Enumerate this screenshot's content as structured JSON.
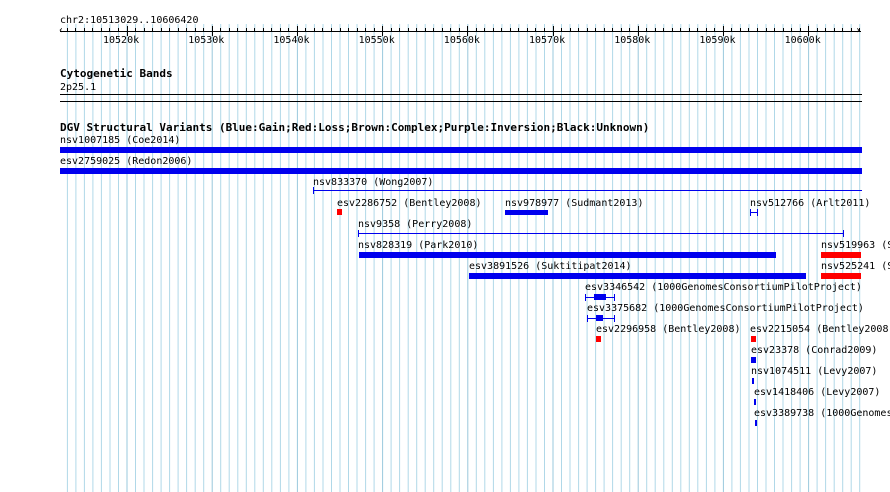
{
  "colors": {
    "gain": "#0000ee",
    "loss": "#ff0000",
    "grid": "#b0d8e8",
    "grid_major": "#9ac8dc",
    "text": "#000000"
  },
  "ruler": {
    "location": "chr2:10513029..10606420",
    "ticks": [
      "10520k",
      "10530k",
      "10540k",
      "10550k",
      "10560k",
      "10570k",
      "10580k",
      "10590k",
      "10600k"
    ]
  },
  "cytoband_track": {
    "title": "Cytogenetic Bands",
    "band": "2p25.1"
  },
  "dgv_track": {
    "title": "DGV Structural Variants (Blue:Gain;Red:Loss;Brown:Complex;Purple:Inversion;Black:Unknown)",
    "features": [
      {
        "label": "nsv1007185 (Coe2014)",
        "type": "gain",
        "style": "bar"
      },
      {
        "label": "esv2759025 (Redon2006)",
        "type": "gain",
        "style": "bar"
      },
      {
        "label": "nsv833370 (Wong2007)",
        "type": "gain",
        "style": "line"
      },
      {
        "label": "esv2286752 (Bentley2008)",
        "type": "loss",
        "style": "box"
      },
      {
        "label": "nsv978977 (Sudmant2013)",
        "type": "gain",
        "style": "bar"
      },
      {
        "label": "nsv512766 (Arlt2011)",
        "type": "gain",
        "style": "line"
      },
      {
        "label": "nsv9358 (Perry2008)",
        "type": "gain",
        "style": "line"
      },
      {
        "label": "nsv828319 (Park2010)",
        "type": "gain",
        "style": "bar"
      },
      {
        "label": "nsv519963 (S",
        "type": "loss",
        "style": "bar"
      },
      {
        "label": "esv3891526 (Suktitipat2014)",
        "type": "gain",
        "style": "bar"
      },
      {
        "label": "nsv525241 (S",
        "type": "loss",
        "style": "bar"
      },
      {
        "label": "esv3346542 (1000GenomesConsortiumPilotProject)",
        "type": "gain",
        "style": "line"
      },
      {
        "label": "esv3375682 (1000GenomesConsortiumPilotProject)",
        "type": "gain",
        "style": "line"
      },
      {
        "label": "esv2296958 (Bentley2008)",
        "type": "loss",
        "style": "box"
      },
      {
        "label": "esv2215054 (Bentley2008)",
        "type": "loss",
        "style": "box"
      },
      {
        "label": "esv23378 (Conrad2009)",
        "type": "gain",
        "style": "box"
      },
      {
        "label": "nsv1074511 (Levy2007)",
        "type": "gain",
        "style": "tick"
      },
      {
        "label": "esv1418406 (Levy2007)",
        "type": "gain",
        "style": "tick"
      },
      {
        "label": "esv3389738 (1000Genomes",
        "type": "gain",
        "style": "tick"
      }
    ]
  }
}
